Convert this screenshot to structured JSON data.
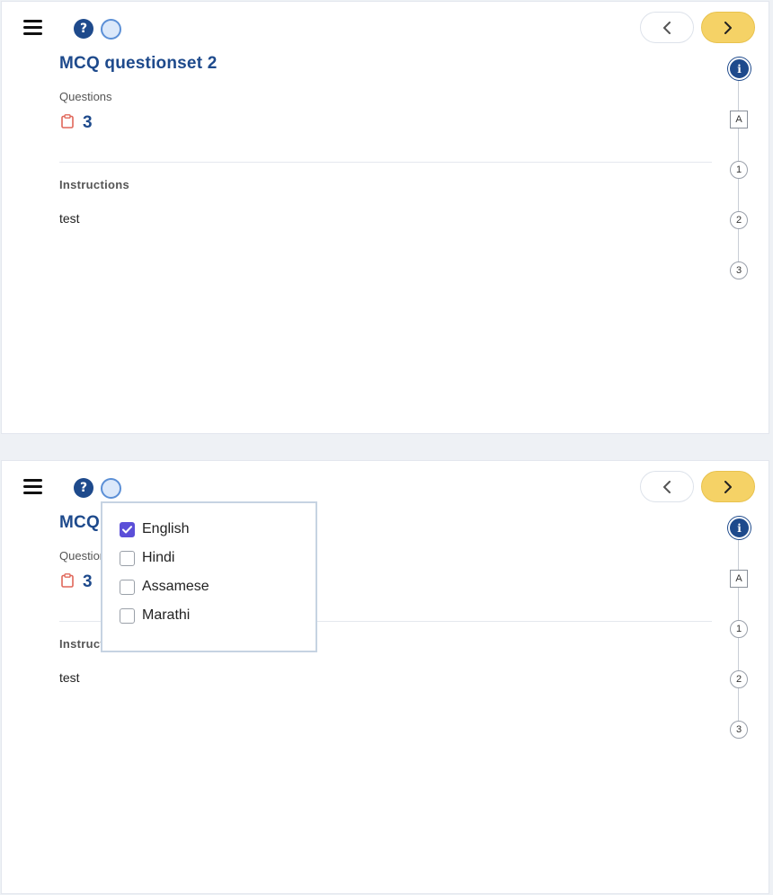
{
  "quiz": {
    "title": "MCQ questionset 2",
    "questions_label": "Questions",
    "question_count": "3",
    "instructions_heading": "Instructions",
    "instructions_text": "test"
  },
  "header": {
    "help_glyph": "?",
    "prev_glyph": "‹",
    "next_glyph": "›"
  },
  "stepper": {
    "info_label": "i",
    "attempt_label": "A",
    "steps": [
      "1",
      "2",
      "3"
    ]
  },
  "language_dropdown": {
    "options": [
      {
        "label": "English",
        "checked": true
      },
      {
        "label": "Hindi",
        "checked": false
      },
      {
        "label": "Assamese",
        "checked": false
      },
      {
        "label": "Marathi",
        "checked": false
      }
    ]
  },
  "colors": {
    "primary": "#1e4a8c",
    "next_button": "#f5d266",
    "checkbox_checked": "#5b4fd8",
    "clipboard_icon": "#e0675a"
  }
}
